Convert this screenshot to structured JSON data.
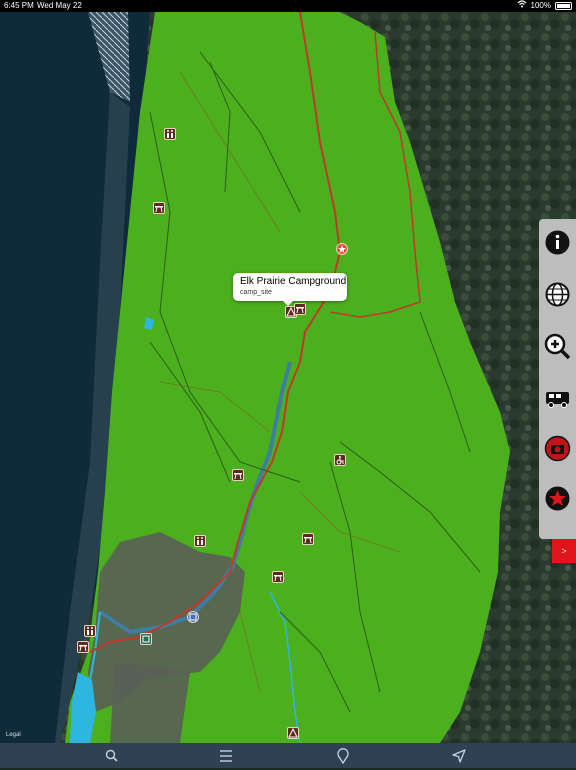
{
  "status_bar": {
    "time": "6:45 PM",
    "date": "Wed May 22",
    "battery": "100%"
  },
  "callout": {
    "title": "Elk Prairie Campground",
    "subtitle": "camp_site"
  },
  "map": {
    "legal_label": "Legal"
  },
  "side_panel": {
    "buttons": [
      "info-icon",
      "globe-icon",
      "zoom-in-icon",
      "rv-icon",
      "camera-icon",
      "star-icon"
    ],
    "expand_label": ">"
  },
  "bottom_bar": {
    "items": [
      "search-icon",
      "list-icon",
      "pin-icon",
      "location-arrow-icon"
    ]
  },
  "colors": {
    "park_green": "#4caf1e",
    "ocean": "#0f2a3a",
    "forest": "#2a3a2c",
    "road": "#c0392b",
    "water": "#2fb6e0",
    "panel": "#bdbdbd",
    "expand_button": "#e0141a",
    "bottom_bar": "#2f4154"
  }
}
